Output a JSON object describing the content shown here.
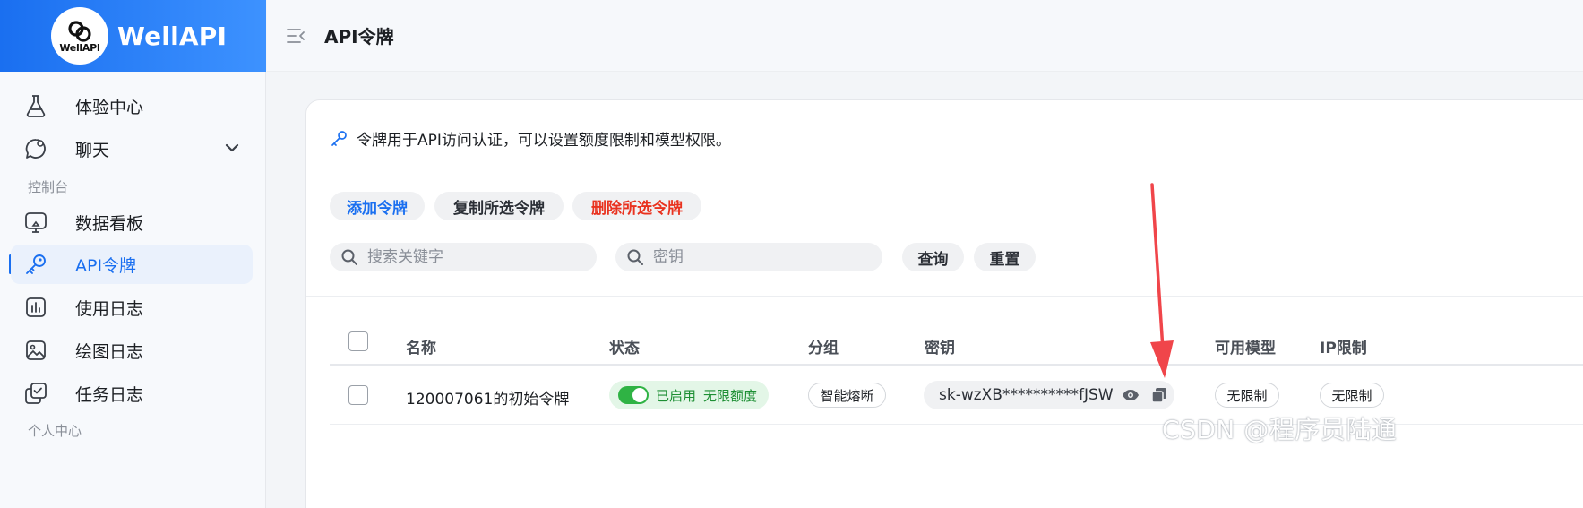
{
  "brand": {
    "name": "WellAPI",
    "logo_text": "WellAPI"
  },
  "header": {
    "title": "API令牌"
  },
  "sidebar": {
    "items": [
      {
        "label": "体验中心",
        "icon": "flask-icon"
      },
      {
        "label": "聊天",
        "icon": "chat-icon"
      },
      {
        "label": "数据看板",
        "icon": "dashboard-icon"
      },
      {
        "label": "API令牌",
        "icon": "key-icon",
        "active": true
      },
      {
        "label": "使用日志",
        "icon": "log-icon"
      },
      {
        "label": "绘图日志",
        "icon": "image-icon"
      },
      {
        "label": "任务日志",
        "icon": "task-icon"
      }
    ],
    "sections": {
      "console": "控制台",
      "personal": "个人中心"
    }
  },
  "main": {
    "info": "令牌用于API访问认证，可以设置额度限制和模型权限。",
    "buttons": {
      "add": "添加令牌",
      "copy": "复制所选令牌",
      "delete": "删除所选令牌"
    },
    "search": {
      "keyword_placeholder": "搜索关键字",
      "key_placeholder": "密钥"
    },
    "actions": {
      "query": "查询",
      "reset": "重置"
    },
    "table": {
      "columns": [
        "名称",
        "状态",
        "分组",
        "密钥",
        "可用模型",
        "IP限制"
      ],
      "rows": [
        {
          "name": "120007061的初始令牌",
          "status": "已启用",
          "quota": "无限额度",
          "group": "智能熔断",
          "key": "sk-wzXB**********fJSW",
          "models": "无限制",
          "ip": "无限制"
        }
      ]
    }
  },
  "watermark": "CSDN @程序员陆通",
  "colors": {
    "primary": "#1a6ff0",
    "danger": "#e9321f",
    "success": "#2fb344",
    "annotation": "#f0454a"
  }
}
